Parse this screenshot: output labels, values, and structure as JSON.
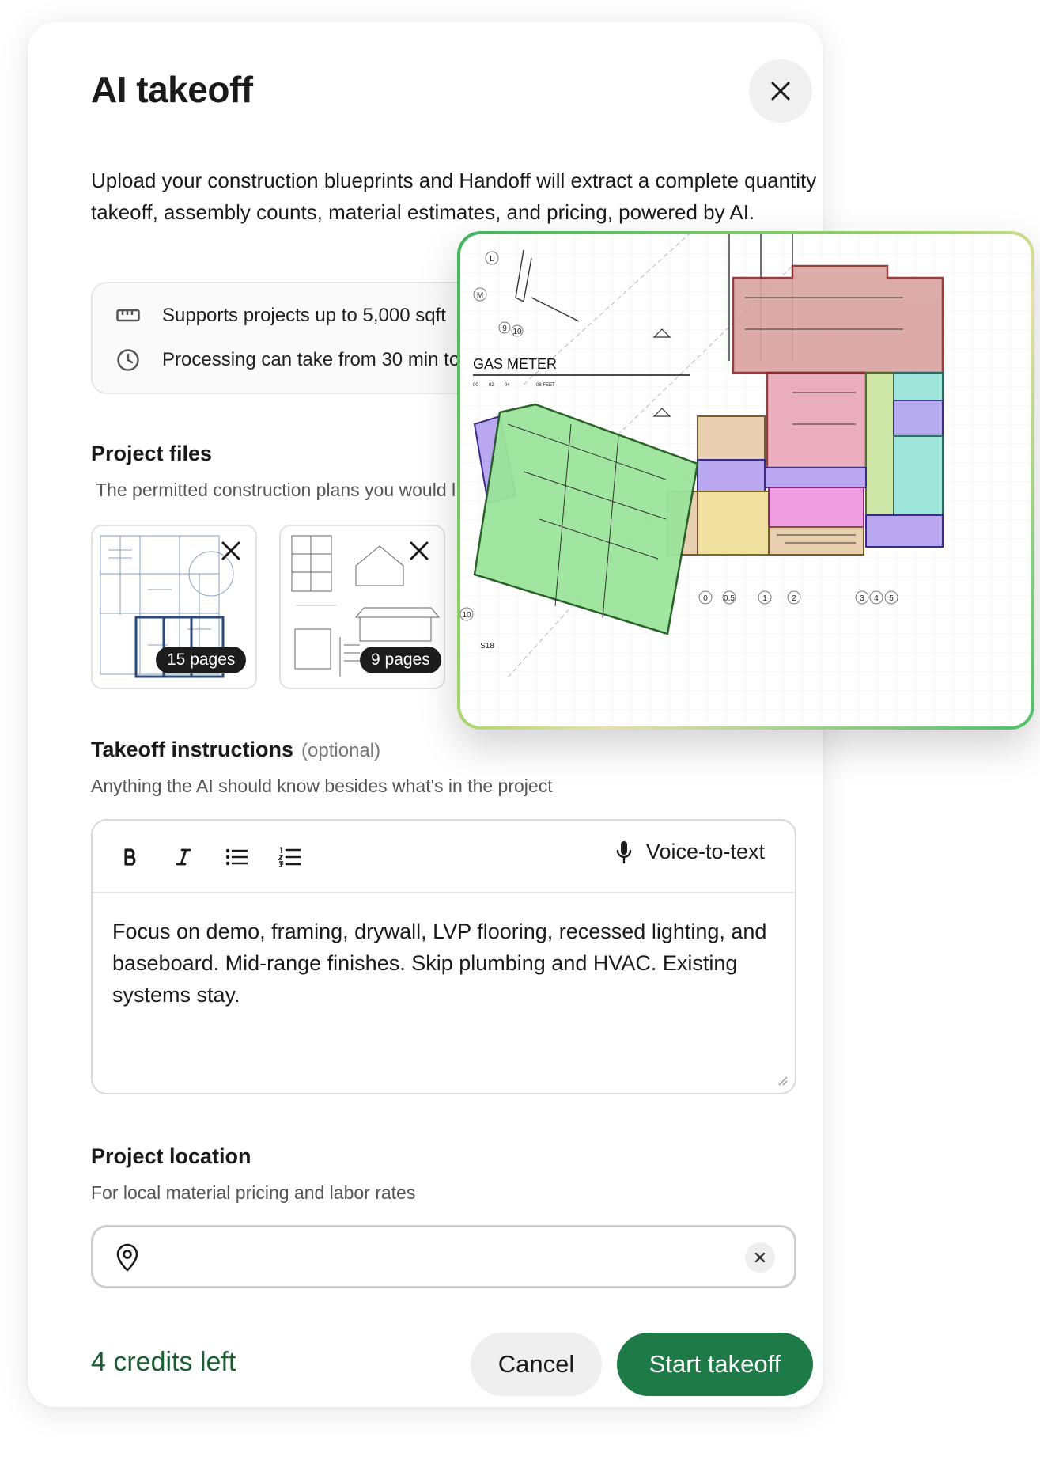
{
  "modal": {
    "title": "AI takeoff",
    "intro": "Upload your construction blueprints and Handoff will extract a complete quantity takeoff, assembly counts, material estimates, and pricing, powered by AI."
  },
  "info": {
    "sqft": "Supports projects up to 5,000 sqft",
    "processing": "Processing can take from 30 min to 2"
  },
  "files": {
    "title": "Project files",
    "subtitle": "The permitted construction plans you would l",
    "items": [
      {
        "pages": "15 pages"
      },
      {
        "pages": "9 pages"
      }
    ]
  },
  "instructions": {
    "title": "Takeoff instructions",
    "optional": "(optional)",
    "subtitle": "Anything the AI should know besides what's in the project",
    "voice_label": "Voice-to-text",
    "text": "Focus on demo, framing, drywall, LVP flooring, recessed lighting, and baseboard. Mid-range finishes. Skip plumbing and HVAC. Existing systems stay."
  },
  "location": {
    "title": "Project location",
    "subtitle": "For local material pricing and labor rates",
    "value": ""
  },
  "footer": {
    "credits": "4 credits left",
    "cancel": "Cancel",
    "start": "Start takeoff"
  },
  "blueprint": {
    "label": "GAS METER",
    "scale_labels": [
      "00",
      "02",
      "04",
      "08 FEET"
    ],
    "grid_markers": [
      "L",
      "M",
      "9",
      "10",
      "0",
      "0.5",
      "1",
      "2",
      "3",
      "4",
      "5",
      "10",
      "S18"
    ]
  },
  "colors": {
    "accent": "#1e7a46",
    "credits_text": "#1b5e33",
    "room_red": "#d9a3a0",
    "room_green": "#9be49b",
    "room_purple": "#b9a7f0",
    "room_pink": "#ef9ee0",
    "room_yellow": "#efe0a0",
    "room_teal": "#9fe4d8",
    "room_lime": "#cfe7a8"
  }
}
